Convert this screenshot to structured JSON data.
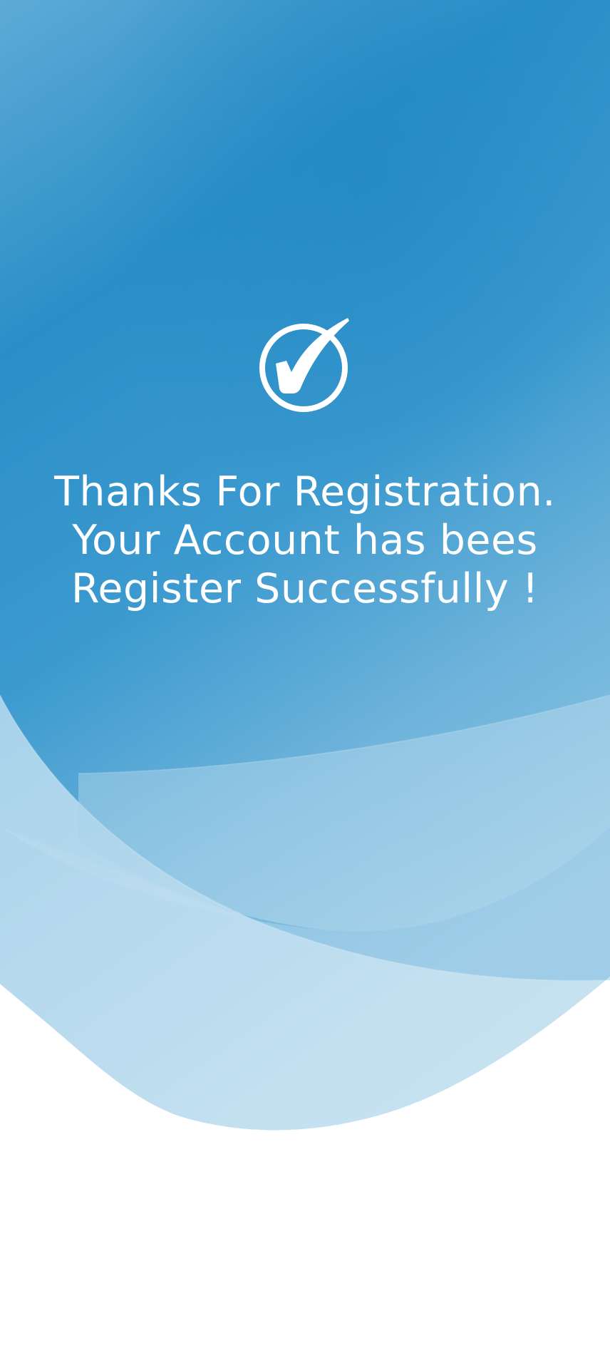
{
  "colors": {
    "primary_blue": "#2790c8",
    "top_blue": "#58a8d4",
    "light_wave": "#a9d3ea",
    "lightest_wave": "#cfe6f2",
    "text": "#ffffff",
    "page_bottom": "#ffffff"
  },
  "status": {
    "icon": "check-circle-icon"
  },
  "message": {
    "line1": "Thanks For Registration.",
    "line2": "Your Account has bees",
    "line3": " Register Successfully !"
  }
}
